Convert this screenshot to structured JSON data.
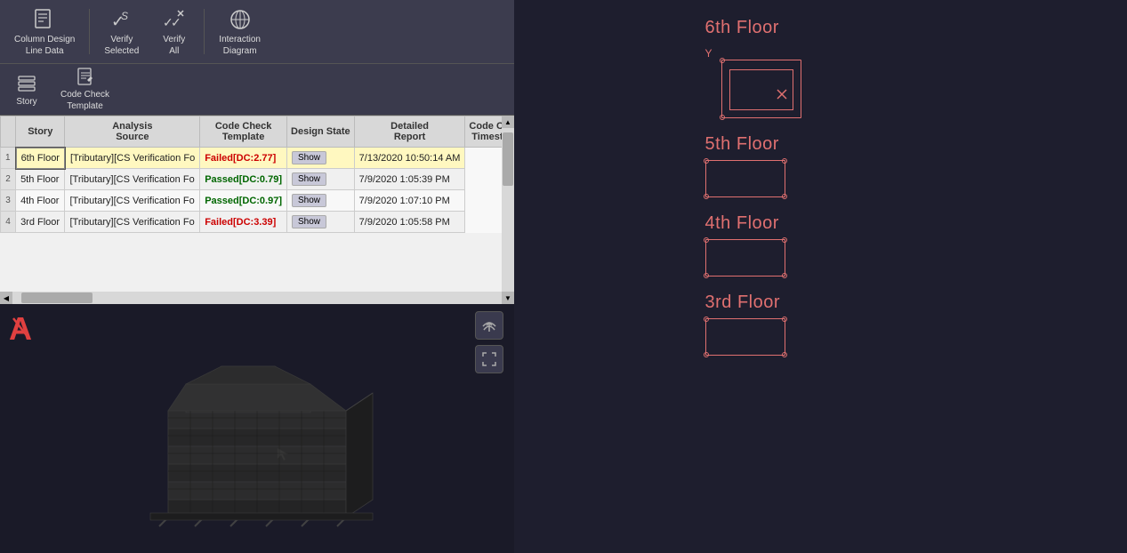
{
  "toolbar": {
    "buttons": [
      {
        "id": "column-design",
        "label": "Column Design\nLine Data",
        "icon": "document-icon"
      },
      {
        "id": "verify-selected",
        "label": "Verify\nSelected",
        "icon": "verify-selected-icon"
      },
      {
        "id": "verify-all",
        "label": "Verify\nAll",
        "icon": "verify-all-icon"
      },
      {
        "id": "interaction-diagram",
        "label": "Interaction\nDiagram",
        "icon": "chart-icon"
      }
    ]
  },
  "ribbon2": {
    "buttons": [
      {
        "id": "story",
        "label": "Story",
        "icon": "story-icon"
      },
      {
        "id": "code-check-template",
        "label": "Code Check\nTemplate",
        "icon": "template-icon"
      }
    ]
  },
  "table": {
    "headers": [
      "Story",
      "Analysis\nSource",
      "Code Check\nTemplate",
      "Design State",
      "Detailed\nReport",
      "Code Check\nTimestamp"
    ],
    "rows": [
      {
        "num": "1",
        "story": "6th Floor",
        "analysis": "[Tributary][CS Verification Fo",
        "template": "CS Verification Fo",
        "state": "Failed[DC:2.77]",
        "state_type": "failed",
        "report": "Show",
        "timestamp": "7/13/2020 10:50:14 AM",
        "selected": true
      },
      {
        "num": "2",
        "story": "5th Floor",
        "analysis": "[Tributary][CS Verification Fo",
        "template": "CS Verification Fo",
        "state": "Passed[DC:0.79]",
        "state_type": "passed",
        "report": "Show",
        "timestamp": "7/9/2020 1:05:39 PM",
        "selected": false
      },
      {
        "num": "3",
        "story": "4th Floor",
        "analysis": "[Tributary][CS Verification Fo",
        "template": "CS Verification Fo",
        "state": "Passed[DC:0.97]",
        "state_type": "passed",
        "report": "Show",
        "timestamp": "7/9/2020 1:07:10 PM",
        "selected": false
      },
      {
        "num": "4",
        "story": "3rd Floor",
        "analysis": "[Tributary][CS Verification Fo",
        "template": "CS Verification Fo",
        "state": "Failed[DC:3.39]",
        "state_type": "failed",
        "report": "Show",
        "timestamp": "7/9/2020 1:05:58 PM",
        "selected": false
      }
    ]
  },
  "viewport": {
    "upload_label": "⬆",
    "expand_label": "⤢"
  },
  "floors": [
    {
      "id": "6th-floor",
      "label": "6th Floor",
      "type": "special"
    },
    {
      "id": "5th-floor",
      "label": "5th Floor",
      "type": "normal"
    },
    {
      "id": "4th-floor",
      "label": "4th Floor",
      "type": "normal"
    },
    {
      "id": "3rd-floor",
      "label": "3rd Floor",
      "type": "normal"
    }
  ],
  "colors": {
    "accent": "#e07070",
    "bg_dark": "#1e1e2e",
    "toolbar_bg": "#3c3c4e"
  }
}
